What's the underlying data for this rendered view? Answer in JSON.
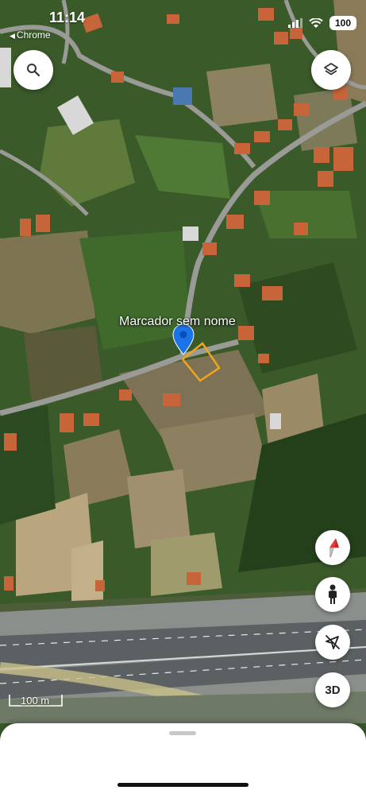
{
  "status_bar": {
    "time": "11:14",
    "back_app": "Chrome",
    "battery": "100"
  },
  "map": {
    "marker_label": "Marcador sem nome",
    "scale_label": "100 m"
  },
  "controls": {
    "search": "search-icon",
    "layers": "layers-icon",
    "compass": "compass-icon",
    "pegman": "pegman-icon",
    "location": "location-off-icon",
    "three_d_label": "3D"
  },
  "colors": {
    "marker": "#1a73e8",
    "parcel_outline": "#f2a516",
    "sheet": "#ffffff"
  }
}
